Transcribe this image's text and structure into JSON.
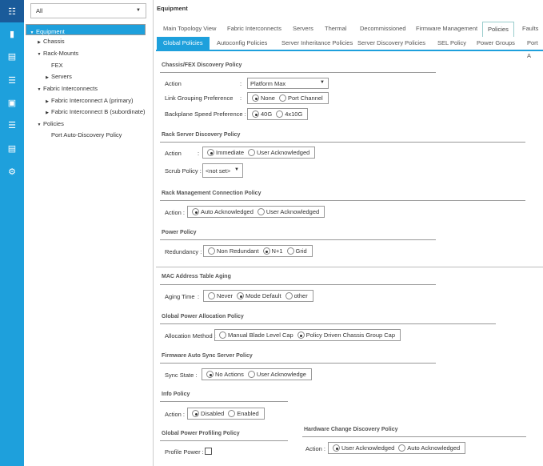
{
  "rail": {
    "items": [
      "topology-icon",
      "server-icon",
      "network-icon",
      "storage-icon",
      "vm-icon",
      "chassis-icon",
      "admin-icon",
      "user-settings-icon"
    ]
  },
  "tree": {
    "filter": "All",
    "items": [
      {
        "label": "Equipment",
        "level": 0,
        "expanded": true,
        "selected": true
      },
      {
        "label": "Chassis",
        "level": 1,
        "expanded": false
      },
      {
        "label": "Rack-Mounts",
        "level": 1,
        "expanded": true
      },
      {
        "label": "FEX",
        "level": 2,
        "leaf": true
      },
      {
        "label": "Servers",
        "level": 2,
        "expanded": false
      },
      {
        "label": "Fabric Interconnects",
        "level": 1,
        "expanded": true
      },
      {
        "label": "Fabric Interconnect A (primary)",
        "level": 2,
        "expanded": false
      },
      {
        "label": "Fabric Interconnect B (subordinate)",
        "level": 2,
        "expanded": false
      },
      {
        "label": "Policies",
        "level": 1,
        "expanded": true
      },
      {
        "label": "Port Auto-Discovery Policy",
        "level": 2,
        "leaf": true
      }
    ]
  },
  "main": {
    "title": "Equipment",
    "tabs": [
      "Main Topology View",
      "Fabric Interconnects",
      "Servers",
      "Thermal",
      "Decommissioned",
      "Firmware Management",
      "Policies",
      "Faults"
    ],
    "subtabs": [
      "Global Policies",
      "Autoconfig Policies",
      "Server Inheritance Policies",
      "Server Discovery Policies",
      "SEL Policy",
      "Power Groups",
      "Port A"
    ],
    "chassis": {
      "heading": "Chassis/FEX Discovery Policy",
      "action_label": "Action",
      "action_value": "Platform Max",
      "link_label": "Link Grouping Preference",
      "link_opts": [
        "None",
        "Port Channel"
      ],
      "backplane_label": "Backplane Speed Preference :",
      "backplane_opts": [
        "40G",
        "4x10G"
      ]
    },
    "rack": {
      "heading": "Rack Server Discovery Policy",
      "action_label": "Action",
      "action_opts": [
        "Immediate",
        "User Acknowledged"
      ],
      "scrub_label": "Scrub Policy :",
      "scrub_value": "<not set>"
    },
    "rmc": {
      "heading": "Rack Management Connection Policy",
      "action_label": "Action :",
      "opts": [
        "Auto Acknowledged",
        "User Acknowledged"
      ]
    },
    "power": {
      "heading": "Power Policy",
      "label": "Redundancy :",
      "opts": [
        "Non Redundant",
        "N+1",
        "Grid"
      ]
    },
    "mac": {
      "heading": "MAC Address Table Aging",
      "label": "Aging Time",
      "opts": [
        "Never",
        "Mode Default",
        "other"
      ]
    },
    "gpa": {
      "heading": "Global Power Allocation Policy",
      "label": "Allocation Method :",
      "opts": [
        "Manual Blade Level Cap",
        "Policy Driven Chassis Group Cap"
      ]
    },
    "fw": {
      "heading": "Firmware Auto Sync Server Policy",
      "label": "Sync State :",
      "opts": [
        "No Actions",
        "User Acknowledge"
      ]
    },
    "info": {
      "heading": "Info Policy",
      "label": "Action :",
      "opts": [
        "Disabled",
        "Enabled"
      ]
    },
    "gpp": {
      "heading": "Global Power Profiling Policy",
      "label": "Profile Power :"
    },
    "hw": {
      "heading": "Hardware Change Discovery Policy",
      "label": "Action :",
      "opts": [
        "User Acknowledged",
        "Auto Acknowledged"
      ]
    }
  },
  "colors": {
    "accent": "#1ea0dc",
    "rail_active": "#1a5b9a"
  }
}
